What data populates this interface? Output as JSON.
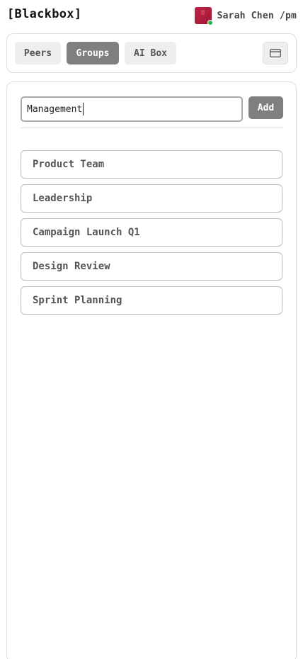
{
  "header": {
    "logo": "[Blackbox]",
    "user": {
      "name": "Sarah Chen /pm",
      "avatar_color": "#b31e3d",
      "status_color": "#2fb54a"
    }
  },
  "nav": {
    "tabs": [
      {
        "label": "Peers",
        "active": false
      },
      {
        "label": "Groups",
        "active": true
      },
      {
        "label": "AI Box",
        "active": false
      }
    ],
    "card_button_icon": "credit-card-icon"
  },
  "groups": {
    "input_value": "Management",
    "add_label": "Add",
    "items": [
      {
        "label": "Product Team"
      },
      {
        "label": "Leadership"
      },
      {
        "label": "Campaign Launch Q1"
      },
      {
        "label": "Design Review"
      },
      {
        "label": "Sprint Planning"
      }
    ]
  },
  "colors": {
    "active_tab": "#7f7f7f",
    "inactive_tab": "#eeeeee",
    "border": "#dddddd"
  }
}
